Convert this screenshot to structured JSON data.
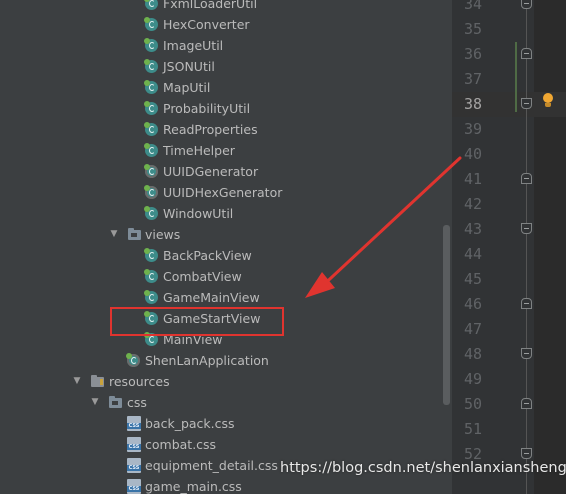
{
  "project_tree": {
    "items": [
      {
        "label": "FxmlLoaderUtil",
        "kind": "class"
      },
      {
        "label": "HexConverter",
        "kind": "class"
      },
      {
        "label": "ImageUtil",
        "kind": "class"
      },
      {
        "label": "JSONUtil",
        "kind": "class"
      },
      {
        "label": "MapUtil",
        "kind": "class"
      },
      {
        "label": "ProbabilityUtil",
        "kind": "class"
      },
      {
        "label": "ReadProperties",
        "kind": "class"
      },
      {
        "label": "TimeHelper",
        "kind": "class"
      },
      {
        "label": "UUIDGenerator",
        "kind": "class"
      },
      {
        "label": "UUIDHexGenerator",
        "kind": "class"
      },
      {
        "label": "WindowUtil",
        "kind": "class"
      },
      {
        "label": "views",
        "kind": "folder",
        "expanded": true
      },
      {
        "label": "BackPackView",
        "kind": "class"
      },
      {
        "label": "CombatView",
        "kind": "class"
      },
      {
        "label": "GameMainView",
        "kind": "class"
      },
      {
        "label": "GameStartView",
        "kind": "class",
        "highlighted": true
      },
      {
        "label": "MainView",
        "kind": "class"
      },
      {
        "label": "ShenLanApplication",
        "kind": "class"
      },
      {
        "label": "resources",
        "kind": "resources-folder",
        "expanded": true
      },
      {
        "label": "css",
        "kind": "folder",
        "expanded": true
      },
      {
        "label": "back_pack.css",
        "kind": "css-file"
      },
      {
        "label": "combat.css",
        "kind": "css-file"
      },
      {
        "label": "equipment_detail.css",
        "kind": "css-file"
      },
      {
        "label": "game_main.css",
        "kind": "css-file"
      }
    ]
  },
  "editor_gutter": {
    "line_numbers": [
      "34",
      "35",
      "36",
      "37",
      "38",
      "39",
      "40",
      "41",
      "42",
      "43",
      "44",
      "45",
      "46",
      "47",
      "48",
      "49",
      "50",
      "51",
      "52"
    ],
    "current_line": "38"
  },
  "icons": {
    "class": "java-class-icon",
    "folder": "folder-icon",
    "css": "css-file-icon",
    "bulb": "intention-bulb-icon",
    "css_badge_text": "CSS"
  },
  "watermark": "https://blog.csdn.net/shenlanxiansheng",
  "colors": {
    "tree_bg": "#3c3f41",
    "gutter_bg": "#313335",
    "editor_bg": "#2b2b2b",
    "highlight_border": "#e0342f",
    "arrow": "#e0342f",
    "class_icon": "#3d8c8a",
    "bulb": "#f0a732"
  }
}
